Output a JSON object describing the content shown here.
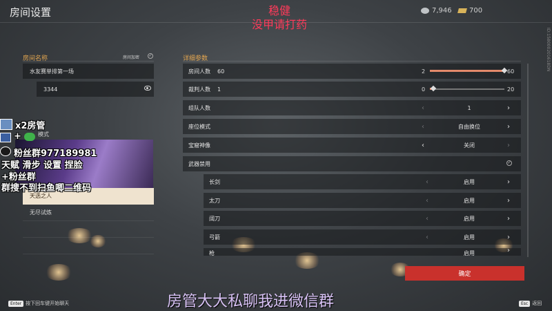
{
  "header": {
    "title": "房间设置",
    "silver": "7,946",
    "gold": "700",
    "watermark": "ID:158000201618DN"
  },
  "overlay": {
    "top_line1": "稳健",
    "top_line2": "没甲请打药",
    "badge": "x2房管",
    "plus": "+",
    "fans": "粉丝群977189981",
    "line1": "天赋 滑步 设置 捏脸",
    "line2": "+粉丝群",
    "line3": "群搜不到扫鱼唧二维码",
    "bottom": "房管大大私聊我进微信群"
  },
  "left": {
    "room_name_label": "房间名称",
    "encrypt_label": "房间加密",
    "room_name_value": "水友赛单排第一场",
    "password_value": "3344",
    "mode_label": "模式",
    "modes": [
      "天选之人",
      "无尽试炼"
    ]
  },
  "right": {
    "section_label": "详细参数",
    "rows": [
      {
        "label": "房间人数",
        "num": "60",
        "min": "2",
        "max": "60",
        "fill": 1.0
      },
      {
        "label": "裁判人数",
        "num": "1",
        "min": "0",
        "max": "20",
        "fill": 0.05
      },
      {
        "label": "组队人数",
        "value": "1"
      },
      {
        "label": "座位模式",
        "value": "自由换位"
      },
      {
        "label": "宝窟神像",
        "value": "关闭"
      },
      {
        "label": "武器禁用"
      }
    ],
    "weapons": [
      {
        "label": "长剑",
        "value": "启用"
      },
      {
        "label": "太刀",
        "value": "启用"
      },
      {
        "label": "阔刀",
        "value": "启用"
      },
      {
        "label": "弓箭",
        "value": "启用"
      },
      {
        "label": "枪",
        "value": "启用"
      }
    ]
  },
  "footer": {
    "confirm": "确定",
    "enter_key": "Enter",
    "enter_text": "按下回车键开始聊天",
    "esc_key": "Esc",
    "esc_text": "返回"
  }
}
